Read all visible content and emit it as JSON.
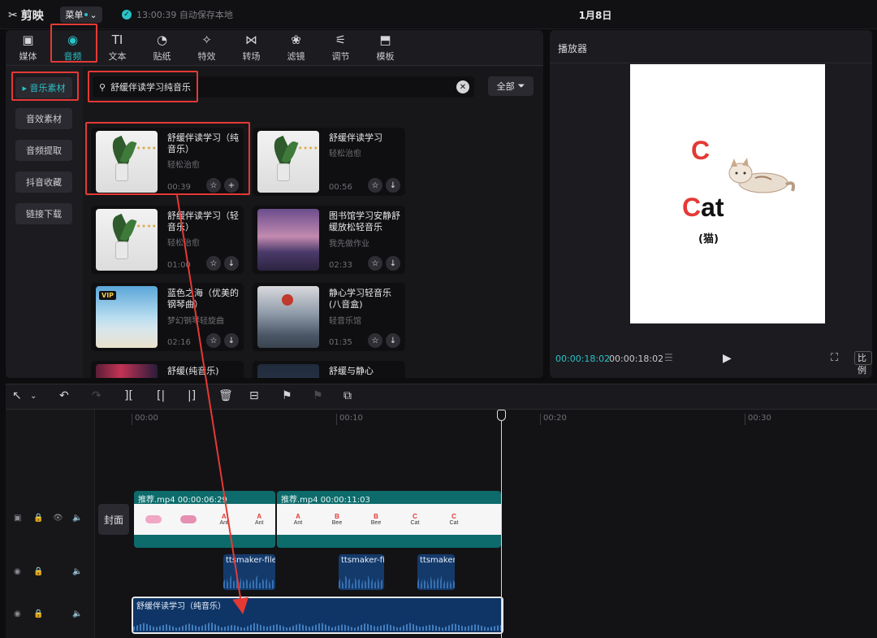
{
  "app": {
    "logo": "剪映",
    "menu": "菜单",
    "autosave": "13:00:39 自动保存本地",
    "project_title": "1月8日"
  },
  "tabs": [
    {
      "label": "媒体",
      "icon": "media-icon"
    },
    {
      "label": "音频",
      "icon": "audio-icon",
      "active": true
    },
    {
      "label": "文本",
      "icon": "text-icon"
    },
    {
      "label": "贴纸",
      "icon": "sticker-icon"
    },
    {
      "label": "特效",
      "icon": "effect-icon"
    },
    {
      "label": "转场",
      "icon": "transition-icon"
    },
    {
      "label": "滤镜",
      "icon": "filter-icon"
    },
    {
      "label": "调节",
      "icon": "adjust-icon"
    },
    {
      "label": "模板",
      "icon": "template-icon"
    }
  ],
  "categories": [
    "音乐素材",
    "音效素材",
    "音频提取",
    "抖音收藏",
    "链接下载"
  ],
  "search": {
    "value": "舒缓伴读学习纯音乐",
    "filter_label": "全部"
  },
  "tracks": [
    {
      "title": "舒缓伴读学习（纯音乐）",
      "artist": "轻松治愈",
      "duration": "00:39",
      "action": "+"
    },
    {
      "title": "舒缓伴读学习",
      "artist": "轻松治愈",
      "duration": "00:56",
      "action": "↓"
    },
    {
      "title": "舒缓伴读学习（轻音乐）",
      "artist": "轻松治愈",
      "duration": "01:00",
      "action": "↓"
    },
    {
      "title": "图书馆学习安静舒缓放松轻音乐",
      "artist": "我先做作业",
      "duration": "02:33",
      "action": "↓"
    },
    {
      "title": "蓝色之海（优美的钢琴曲）",
      "artist": "梦幻钢琴轻旋曲",
      "duration": "02:16",
      "action": "↓"
    },
    {
      "title": "静心学习轻音乐(八音盒)",
      "artist": "轻音乐馆",
      "duration": "01:35",
      "action": "↓"
    },
    {
      "title": "舒缓(纯音乐)",
      "artist": "",
      "duration": "",
      "action": ""
    },
    {
      "title": "舒缓与静心",
      "artist": "",
      "duration": "",
      "action": ""
    }
  ],
  "player": {
    "title": "播放器",
    "big_letter": "C",
    "word_first": "C",
    "word_rest": "at",
    "word_cn": "(猫)",
    "time_current": "00:00:18:02",
    "time_total": "00:00:18:02",
    "ratio_label": "比例"
  },
  "timeline": {
    "ruler": [
      "00:00",
      "00:10",
      "00:20",
      "00:30"
    ],
    "cover_label": "封面",
    "video_clips": [
      {
        "label": "推荐.mp4   00:00:06:29"
      },
      {
        "label": "推荐.mp4   00:00:11:03"
      }
    ],
    "frames": [
      {
        "letter": "A",
        "word": "Ant"
      },
      {
        "letter": "A",
        "word": "Ant"
      },
      {
        "letter": "B",
        "word": "Bee"
      },
      {
        "letter": "B",
        "word": "Bee"
      },
      {
        "letter": "C",
        "word": "Cat"
      },
      {
        "letter": "C",
        "word": "Cat"
      }
    ],
    "audio_clips": [
      {
        "label": "ttsmaker-file"
      },
      {
        "label": "ttsmaker-fi"
      },
      {
        "label": "ttsmaker"
      }
    ],
    "music_clip": "舒缓伴读学习（纯音乐）"
  },
  "colors": {
    "accent": "#29c2c7",
    "highlight": "#e53935",
    "video_clip": "#0d6b6b",
    "audio_clip": "#143a6b"
  }
}
